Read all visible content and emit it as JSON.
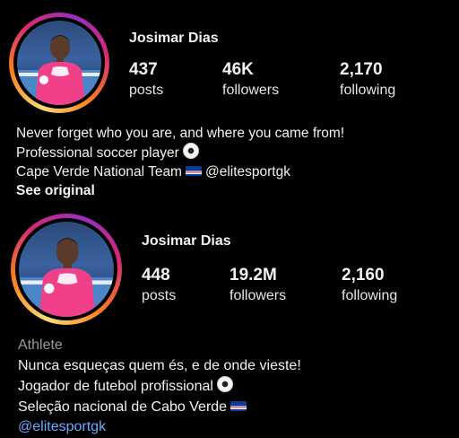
{
  "profile_original": {
    "name": "Josimar Dias",
    "stats": [
      {
        "value": "437",
        "label": "posts"
      },
      {
        "value": "46K",
        "label": "followers"
      },
      {
        "value": "2,170",
        "label": "following"
      }
    ],
    "bio": {
      "line1": "Never forget who you are, and where you came from!",
      "line2": "Professional soccer player",
      "line3_text": "Cape Verde National Team",
      "line3_handle": "@elitesportgk",
      "see_original": "See original"
    }
  },
  "profile_translated": {
    "name": "Josimar Dias",
    "stats": [
      {
        "value": "448",
        "label": "posts"
      },
      {
        "value": "19.2M",
        "label": "followers"
      },
      {
        "value": "2,160",
        "label": "following"
      }
    ],
    "category": "Athlete",
    "bio": {
      "line1": "Nunca esqueças quem és, e de onde vieste!",
      "line2": "Jogador de futebol profissional",
      "line3": "Seleção nacional de Cabo Verde",
      "handle": "@elitesportgk"
    }
  },
  "icons": {
    "ball": "soccer-ball-icon",
    "flag": "cape-verde-flag-icon"
  },
  "colors": {
    "background": "#000000",
    "link": "#6fa8ff",
    "category": "#9a9aa6"
  }
}
